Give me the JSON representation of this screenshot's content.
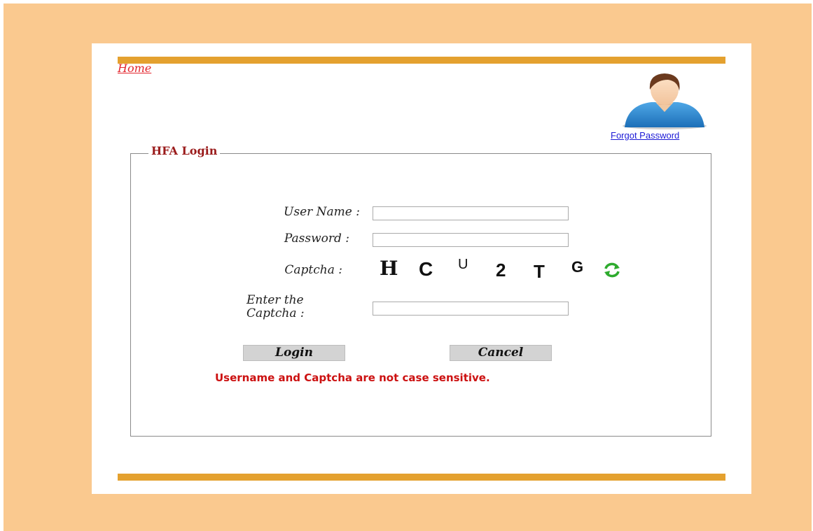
{
  "nav": {
    "home_label": "Home"
  },
  "header": {
    "forgot_password_label": "Forgot Password"
  },
  "form": {
    "legend": "HFA Login",
    "username_label": "User Name :",
    "password_label": "Password :",
    "captcha_label": "Captcha :",
    "enter_captcha_label": "Enter the Captcha :",
    "username_value": "",
    "password_value": "",
    "captcha_value": "",
    "captcha_chars": [
      "H",
      "C",
      "U",
      "2",
      "T",
      "G"
    ],
    "login_label": "Login",
    "cancel_label": "Cancel",
    "note": "Username and Captcha are not case sensitive."
  },
  "icons": {
    "avatar": "user-avatar-icon",
    "refresh": "refresh-icon"
  },
  "colors": {
    "page_bg": "#fac98f",
    "accent_bar": "#e4a12f",
    "legend": "#9a1b1b",
    "error_note": "#cc1111",
    "home_link": "#e3262e",
    "forgot_link": "#1c1ad6",
    "refresh_icon": "#2eab2e"
  }
}
